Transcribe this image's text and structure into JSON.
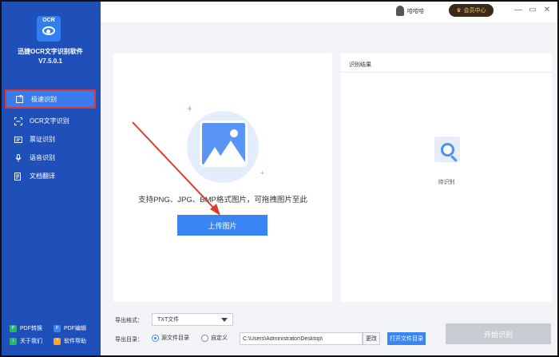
{
  "app": {
    "logo_text": "OCR",
    "name_line1": "迅捷OCR文字识别软件",
    "version": "V7.5.0.1"
  },
  "sidebar": {
    "items": [
      {
        "label": "极速识别",
        "icon": "image-upload-icon",
        "active": true
      },
      {
        "label": "OCR文字识别",
        "icon": "scan-frame-icon"
      },
      {
        "label": "票证识别",
        "icon": "ticket-icon"
      },
      {
        "label": "语音识别",
        "icon": "microphone-icon"
      },
      {
        "label": "文档翻译",
        "icon": "translate-icon"
      }
    ],
    "bottom_links": [
      {
        "label": "PDF转换",
        "icon": "pdf-convert-icon",
        "color": "#2fb36b"
      },
      {
        "label": "PDF编辑",
        "icon": "pdf-edit-icon",
        "color": "#3a85f4"
      },
      {
        "label": "关于我们",
        "icon": "info-icon",
        "color": "#2fb36b"
      },
      {
        "label": "软件帮助",
        "icon": "help-icon",
        "color": "#f5a623"
      }
    ]
  },
  "header": {
    "username": "哈哈哈",
    "vip_label": "会员中心",
    "window_controls": [
      "minimize-icon",
      "restore-icon",
      "close-icon"
    ]
  },
  "upload_panel": {
    "hint": "支持PNG、JPG、BMP格式图片，可拖拽图片至此",
    "upload_button": "上传图片"
  },
  "result_panel": {
    "title": "识别结果",
    "status": "待识别"
  },
  "export": {
    "format_label": "导出格式：",
    "format_value": "TXT文件",
    "dir_label": "导出目录：",
    "radio_source": "源文件目录",
    "radio_custom": "自定义",
    "selected_radio": "source",
    "path_value": "C:\\Users\\Administrator\\Desktop\\",
    "change_button": "更改",
    "open_dir_button": "打开文件目录",
    "start_button": "开始识别"
  },
  "colors": {
    "sidebar_bg": "#1f4fb8",
    "accent": "#3a85f4",
    "highlight_border": "#e0382f",
    "disabled_button": "#c8ccd2"
  }
}
